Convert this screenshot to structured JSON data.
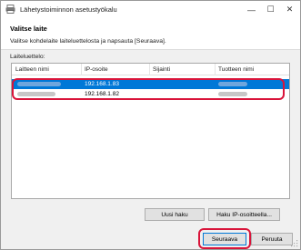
{
  "window": {
    "title": "Lähetystoiminnon asetustyökalu",
    "app_icon": "printer-icon",
    "controls": {
      "minimize": "—",
      "maximize": "☐",
      "close": "✕"
    }
  },
  "header": {
    "page_title": "Valitse laite",
    "instruction": "Valitse kohdelaite laiteluettelosta ja napsauta [Seuraava]."
  },
  "device_list": {
    "label": "Laiteluettelo:",
    "columns": [
      "Laitteen nimi",
      "IP-osoite",
      "Sijainti",
      "Tuotteen nimi"
    ],
    "rows": [
      {
        "ip": "192.168.1.83",
        "selected": true
      },
      {
        "ip": "192.168.1.82",
        "selected": false
      }
    ]
  },
  "buttons": {
    "new_search": "Uusi haku",
    "ip_search": "Haku IP-osoitteella...",
    "next": "Seuraava",
    "cancel": "Peruuta"
  },
  "colors": {
    "selection": "#0078d7",
    "highlight": "#d9143a"
  }
}
